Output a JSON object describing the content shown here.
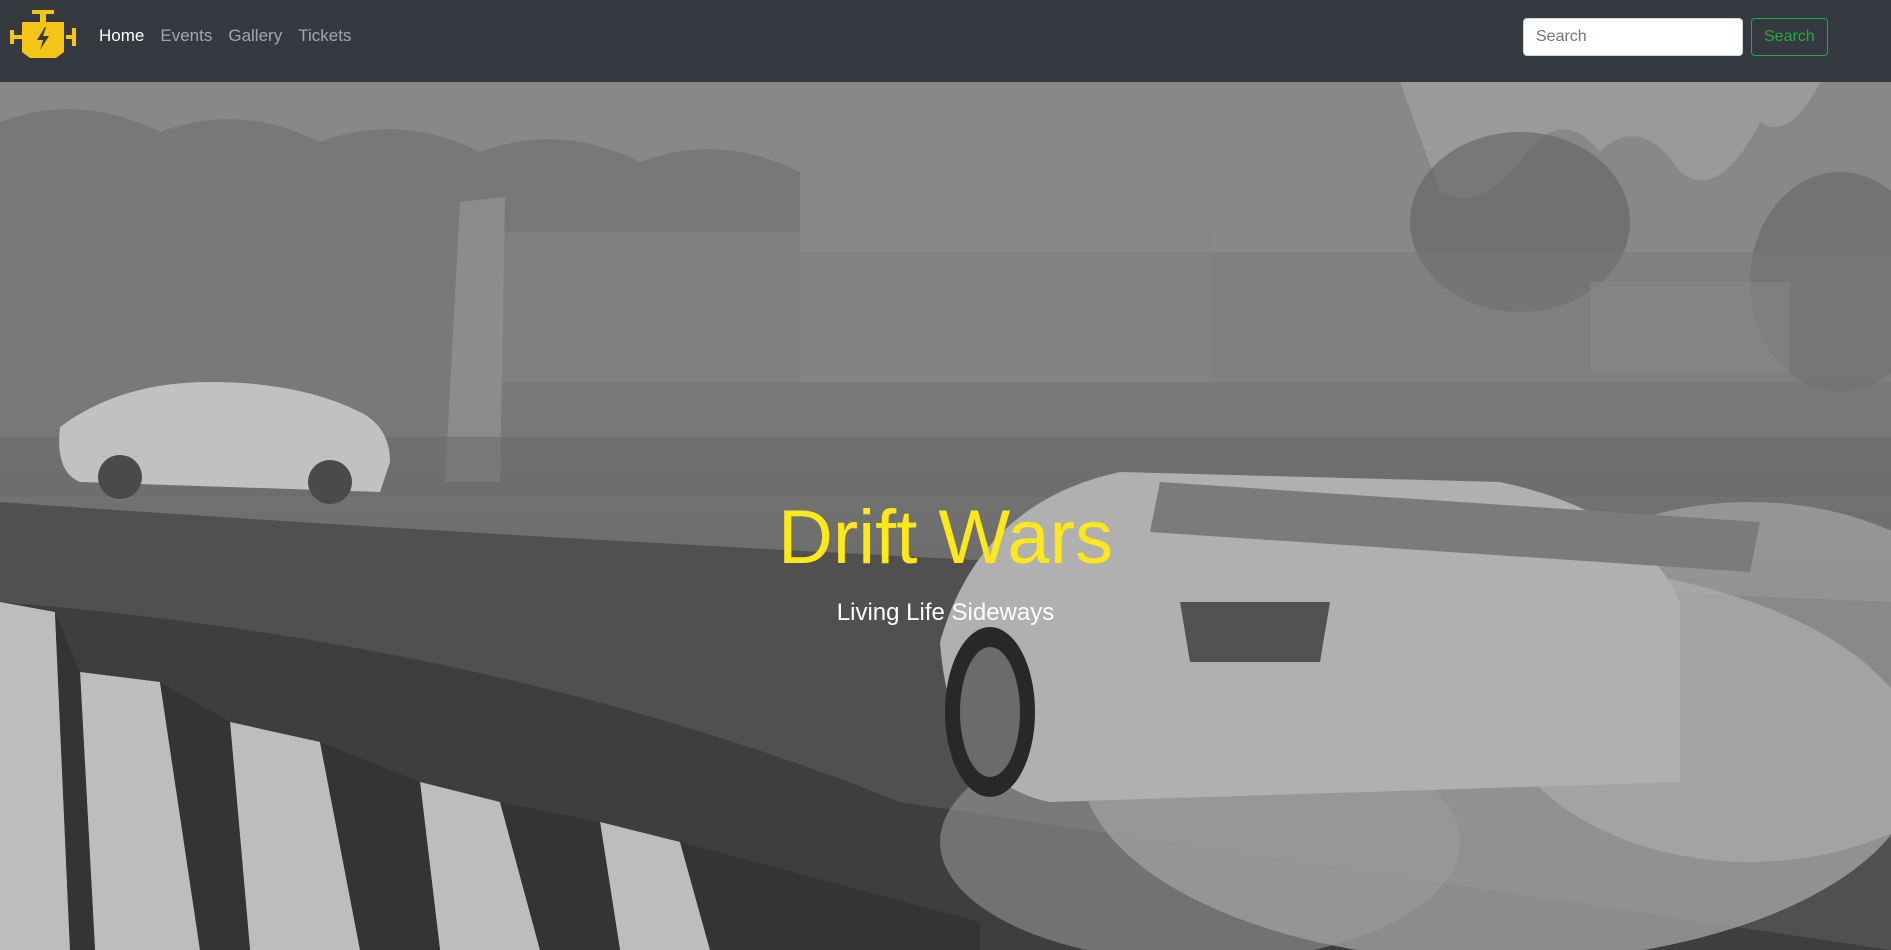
{
  "brand": {
    "logo_icon": "engine-warning-icon",
    "logo_color": "#f5c518"
  },
  "nav": {
    "items": [
      {
        "label": "Home",
        "active": true
      },
      {
        "label": "Events",
        "active": false
      },
      {
        "label": "Gallery",
        "active": false
      },
      {
        "label": "Tickets",
        "active": false
      }
    ]
  },
  "search": {
    "placeholder": "Search",
    "button_label": "Search",
    "button_color": "#28a745"
  },
  "hero": {
    "title": "Drift Wars",
    "subtitle": "Living Life Sideways",
    "title_color": "#ffe81a",
    "background": "grayscale photo of drifting race car with tire smoke"
  }
}
